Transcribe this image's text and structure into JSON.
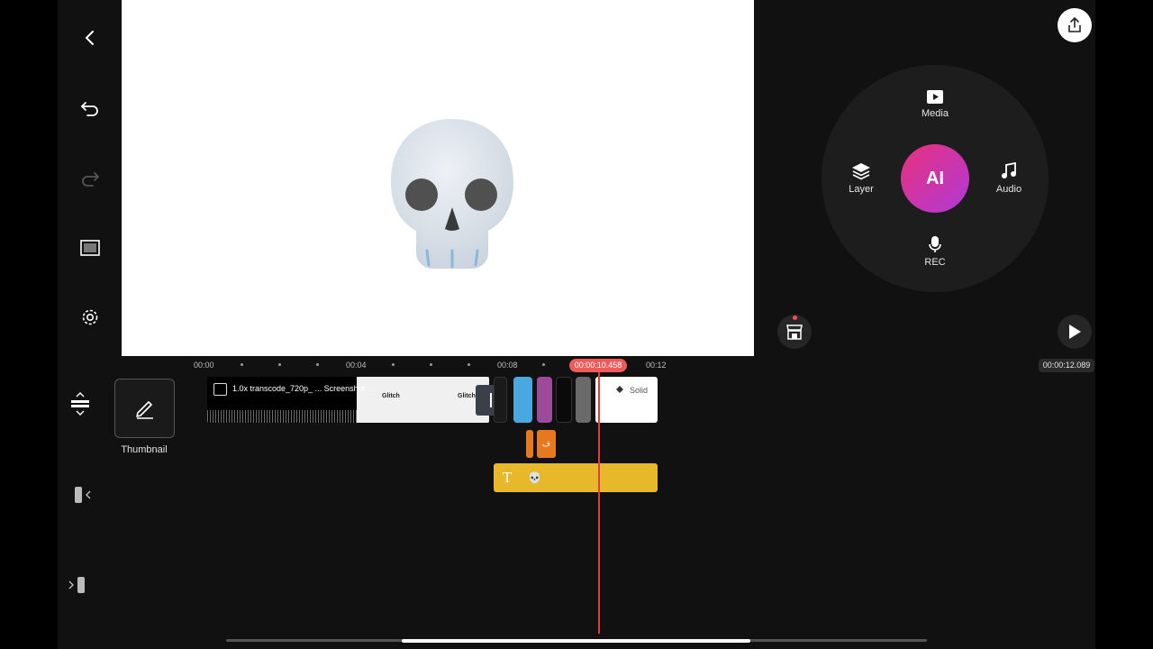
{
  "toolbar": {
    "icons": [
      "back-arrow-icon",
      "undo-icon",
      "redo-icon",
      "fullscreen-icon",
      "settings-icon"
    ]
  },
  "preview": {
    "sticker": "skull"
  },
  "right_panel": {
    "media_label": "Media",
    "layer_label": "Layer",
    "ai_label": "AI",
    "audio_label": "Audio",
    "rec_label": "REC"
  },
  "timeline": {
    "ruler": [
      "00:00",
      "00:04",
      "00:08",
      "00:12"
    ],
    "current_time": "00:00:10.458",
    "total_time": "00:00:12.089",
    "thumbnail_label": "Thumbnail",
    "clip_title": "1.0x transcode_720p_ ... Screenshot ...",
    "solid_label": "Solid",
    "text_clip_label": "T",
    "text_clip_content": "💀",
    "orange_clip_label": "ف",
    "glitch_label": "Glitch",
    "accent_colors": {
      "playhead": "#e23b3b",
      "text_clip": "#e6b82a",
      "audio_clip": "#e6781e",
      "ai_gradient_start": "#e8307c",
      "ai_gradient_end": "#b03ad6"
    }
  }
}
